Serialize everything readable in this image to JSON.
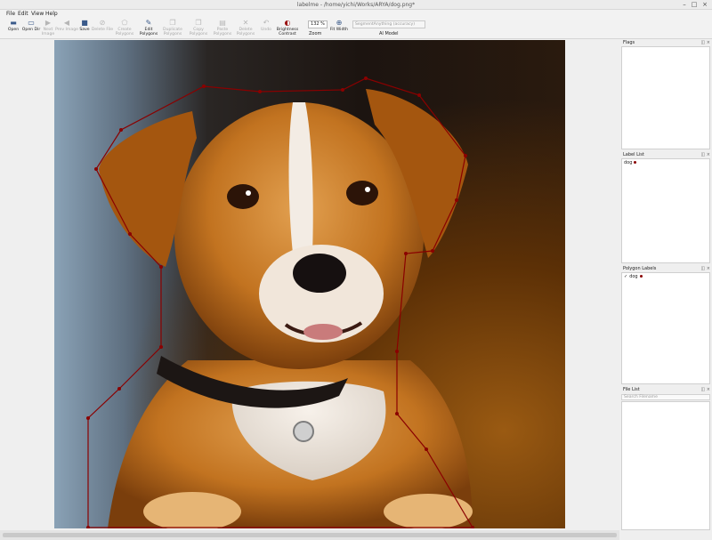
{
  "window": {
    "title": "labelme - /home/yichi/Works/ARYA/dog.png*"
  },
  "menu": [
    "File",
    "Edit",
    "View",
    "Help"
  ],
  "toolbar": {
    "tools": [
      {
        "id": "open",
        "label": "Open",
        "icon": "folder-icon",
        "enabled": true
      },
      {
        "id": "open-dir",
        "label": "Open Dir",
        "icon": "folder-open-icon",
        "enabled": true
      },
      {
        "id": "next-image",
        "label": "Next Image",
        "icon": "arrow-right-icon",
        "enabled": false
      },
      {
        "id": "prev-image",
        "label": "Prev Image",
        "icon": "arrow-left-icon",
        "enabled": false
      },
      {
        "id": "save",
        "label": "Save",
        "icon": "save-icon",
        "enabled": true
      },
      {
        "id": "delete-file",
        "label": "Delete File",
        "icon": "delete-icon",
        "enabled": false
      },
      {
        "id": "create-polygons",
        "label": "Create Polygons",
        "icon": "polygon-icon",
        "enabled": false
      },
      {
        "id": "edit-polygons",
        "label": "Edit Polygons",
        "icon": "edit-icon",
        "enabled": true
      },
      {
        "id": "duplicate-polygons",
        "label": "Duplicate Polygons",
        "icon": "copy-icon",
        "enabled": false
      },
      {
        "id": "copy-polygons",
        "label": "Copy Polygons",
        "icon": "copy-icon",
        "enabled": false
      },
      {
        "id": "paste-polygons",
        "label": "Paste Polygons",
        "icon": "paste-icon",
        "enabled": false
      },
      {
        "id": "delete-polygons",
        "label": "Delete Polygons",
        "icon": "delete-icon",
        "enabled": false
      },
      {
        "id": "undo",
        "label": "Undo",
        "icon": "undo-icon",
        "enabled": false
      },
      {
        "id": "brightness-contrast",
        "label": "Brightness Contrast",
        "icon": "brightness-icon",
        "enabled": true
      },
      {
        "id": "fit-width",
        "label": "Fit Width",
        "icon": "fit-width-icon",
        "enabled": true
      }
    ],
    "zoom_value": "132 %",
    "zoom_label": "Zoom",
    "ai_model_value": "SegmentAnything (accuracy)",
    "ai_model_label": "AI Model"
  },
  "docks": {
    "flags": {
      "title": "Flags"
    },
    "label_list": {
      "title": "Label List",
      "items": [
        {
          "label": "dog",
          "color": "#8a0000"
        }
      ]
    },
    "polygon_labels": {
      "title": "Polygon Labels",
      "items": [
        {
          "label": "dog",
          "checked": true,
          "color": "#8a0000"
        }
      ]
    },
    "file_list": {
      "title": "File List",
      "search_placeholder": "Search Filename"
    }
  },
  "polygon": {
    "label": "dog",
    "color": "#8a0000"
  }
}
